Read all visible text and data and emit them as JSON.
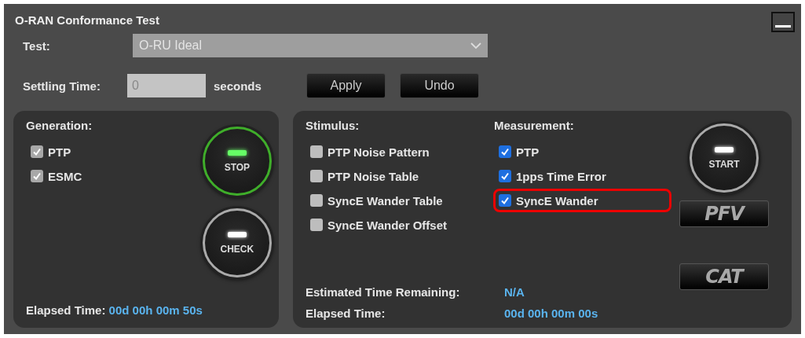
{
  "window": {
    "title": "O-RAN Conformance Test"
  },
  "test": {
    "label": "Test:",
    "value": "O-RU Ideal",
    "disabled": true
  },
  "settling": {
    "label": "Settling Time:",
    "value": "0",
    "unit": "seconds"
  },
  "actions": [
    "Apply",
    "Undo"
  ],
  "generation": {
    "title": "Generation:",
    "items": [
      {
        "label": "PTP",
        "checked": true,
        "disabled": true
      },
      {
        "label": "ESMC",
        "checked": true,
        "disabled": true
      }
    ],
    "buttons": [
      {
        "label": "STOP",
        "active": true
      },
      {
        "label": "CHECK",
        "active": false
      }
    ],
    "elapsed_label": "Elapsed Time:",
    "elapsed_value": "00d 00h 00m 50s"
  },
  "stimulus": {
    "title": "Stimulus:",
    "items": [
      {
        "label": "PTP Noise Pattern",
        "checked": false,
        "highlighted": false
      },
      {
        "label": "PTP Noise Table",
        "checked": false,
        "highlighted": false
      },
      {
        "label": "SyncE Wander Table",
        "checked": false,
        "highlighted": false
      },
      {
        "label": "SyncE Wander Offset",
        "checked": false,
        "highlighted": false
      }
    ]
  },
  "measurement": {
    "title": "Measurement:",
    "items": [
      {
        "label": "PTP",
        "checked": true,
        "highlighted": false
      },
      {
        "label": "1pps Time Error",
        "checked": true,
        "highlighted": false
      },
      {
        "label": "SyncE Wander",
        "checked": true,
        "highlighted": true
      }
    ]
  },
  "run": {
    "buttons": [
      {
        "label": "START",
        "active": false
      }
    ],
    "logos": [
      "PFV",
      "CAT"
    ]
  },
  "remaining": {
    "label": "Estimated Time Remaining:",
    "value": "N/A"
  },
  "elapsed": {
    "label": "Elapsed Time:",
    "value": "00d 00h 00m 00s"
  }
}
